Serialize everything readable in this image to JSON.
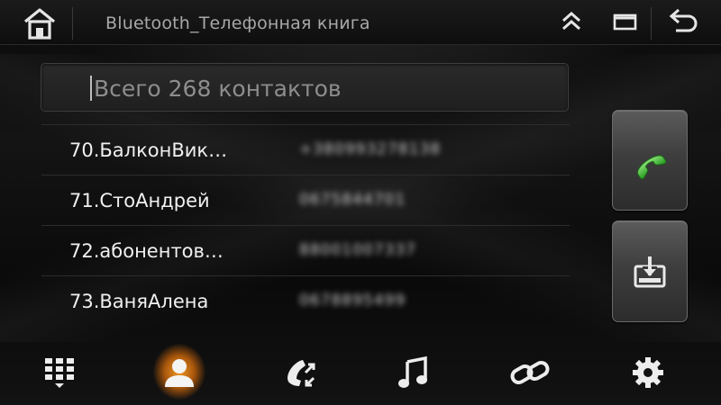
{
  "header": {
    "title": "Bluetooth_Телефонная книга",
    "icons": {
      "home": "home-icon",
      "collapse": "chevron-double-up-icon",
      "window": "window-icon",
      "back": "back-arrow-icon"
    }
  },
  "search": {
    "placeholder": "Всего 268 контактов",
    "value": ""
  },
  "contacts": [
    {
      "name": "70.БалконВик…",
      "number": "+380993278138"
    },
    {
      "name": "71.СтоАндрей",
      "number": "0675844701"
    },
    {
      "name": "72.абонентов…",
      "number": "88001007337"
    },
    {
      "name": "73.ВаняАлена",
      "number": "0678895499"
    }
  ],
  "side_buttons": [
    {
      "icon": "phone-call-icon",
      "color": "#3fbf3a"
    },
    {
      "icon": "download-tray-icon"
    }
  ],
  "bottom_nav": [
    {
      "icon": "dialpad-icon",
      "active": false
    },
    {
      "icon": "contacts-icon",
      "active": true
    },
    {
      "icon": "call-log-icon",
      "active": false
    },
    {
      "icon": "music-note-icon",
      "active": false
    },
    {
      "icon": "link-icon",
      "active": false
    },
    {
      "icon": "settings-gear-icon",
      "active": false
    }
  ],
  "colors": {
    "accent": "#f39a1e",
    "call_green": "#3fbf3a"
  }
}
